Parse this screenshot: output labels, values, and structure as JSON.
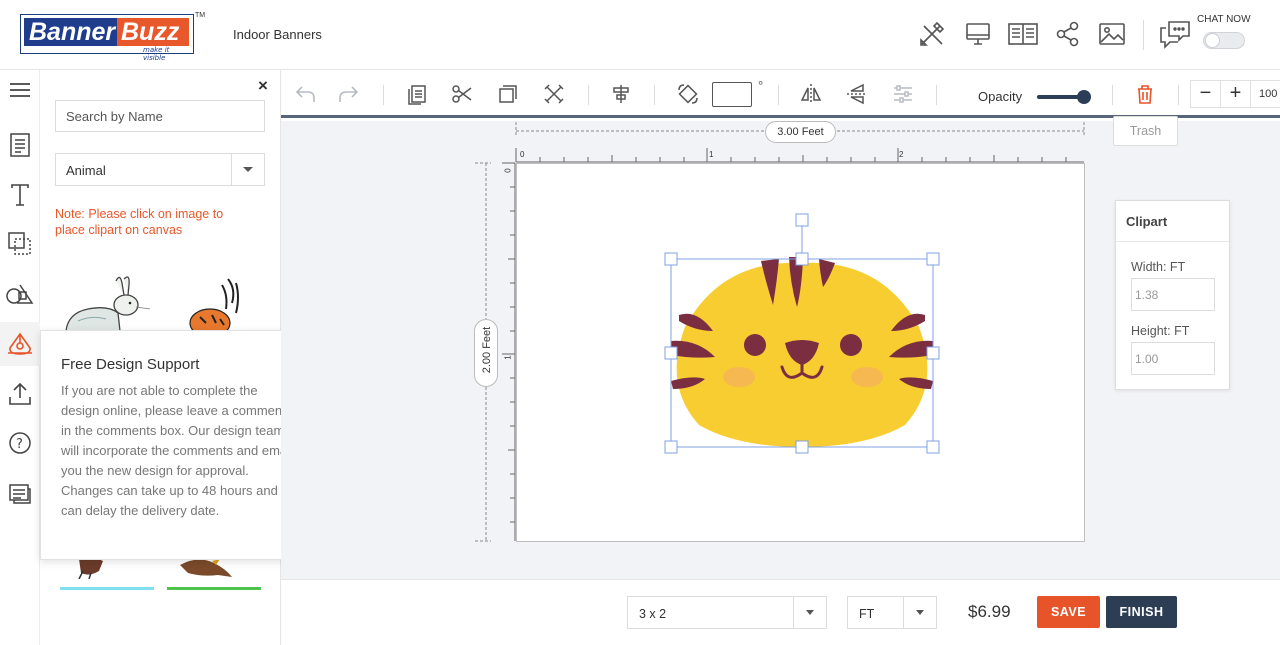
{
  "header": {
    "logo_part1": "Banner",
    "logo_part2": "Buzz",
    "logo_tagline": "make it visible",
    "logo_tm": "TM",
    "product_name": "Indoor Banners",
    "chat_now": "CHAT NOW",
    "icons": [
      "design-tools-icon",
      "preview-monitor-icon",
      "book-view-icon",
      "share-icon",
      "image-upload-icon",
      "chat-icon"
    ]
  },
  "rail": {
    "items": [
      "menu-icon",
      "template-icon",
      "text-icon",
      "layers-icon",
      "shapes-icon",
      "clipart-icon",
      "upload-icon",
      "help-icon",
      "comments-icon"
    ],
    "active": "clipart-icon"
  },
  "clip_panel": {
    "close": "×",
    "search_placeholder": "Search by Name",
    "category": "Animal",
    "note": "Note: Please click on image to place clipart on canvas"
  },
  "support_popup": {
    "title": "Free Design Support",
    "close": "×",
    "body": "If you are not able to complete the design online, please leave a comments in the comments box. Our design team will incorporate the comments and email you the new design for approval. Changes can take up to 48 hours and can delay the delivery date."
  },
  "toolbar": {
    "tools": [
      "undo-icon",
      "redo-icon",
      "copy-icon",
      "cut-icon",
      "duplicate-icon",
      "delete-x-icon",
      "align-center-icon",
      "rotate-icon",
      "flip-horizontal-icon",
      "flip-vertical-icon",
      "adjust-icon",
      "trash-icon"
    ],
    "rotate_value": "",
    "degree_symbol": "°",
    "opacity_label": "Opacity",
    "opacity_value": 1.0,
    "zoom_minus": "−",
    "zoom_plus": "+",
    "zoom_value": "100",
    "trash_tooltip": "Trash"
  },
  "canvas": {
    "width_label": "3.00 Feet",
    "height_label": "2.00 Feet",
    "ruler_x": [
      "0",
      "1",
      "2"
    ],
    "ruler_y": [
      "0",
      "1"
    ]
  },
  "clipart_props": {
    "title": "Clipart",
    "width_label": "Width: FT",
    "width_value": "1.38",
    "height_label": "Height: FT",
    "height_value": "1.00"
  },
  "footer": {
    "size": "3 x 2",
    "unit": "FT",
    "price": "$6.99",
    "save": "SAVE",
    "finish": "FINISH"
  },
  "colors": {
    "accent": "#e8542a",
    "dark": "#2d3d54",
    "logo_blue": "#1f3d8c",
    "tiger_yellow": "#f7cd31",
    "tiger_stripe": "#7b2e40"
  }
}
